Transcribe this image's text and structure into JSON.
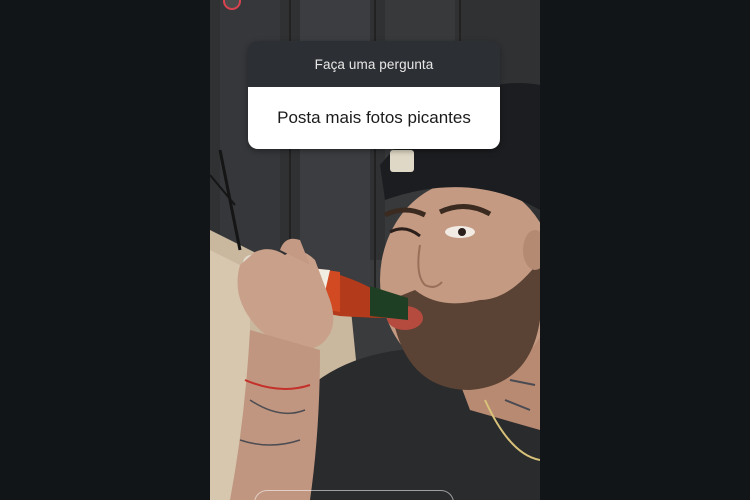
{
  "question_sticker": {
    "header": "Faça uma pergunta",
    "answer": "Posta mais fotos picantes"
  },
  "colors": {
    "page_background": "#121518",
    "sticker_header": "#2c2f33",
    "sticker_body": "#ffffff",
    "story_ring": "#d9434f"
  },
  "photo": {
    "subject": "man-drinking-hot-sauce-bottle-icon"
  }
}
